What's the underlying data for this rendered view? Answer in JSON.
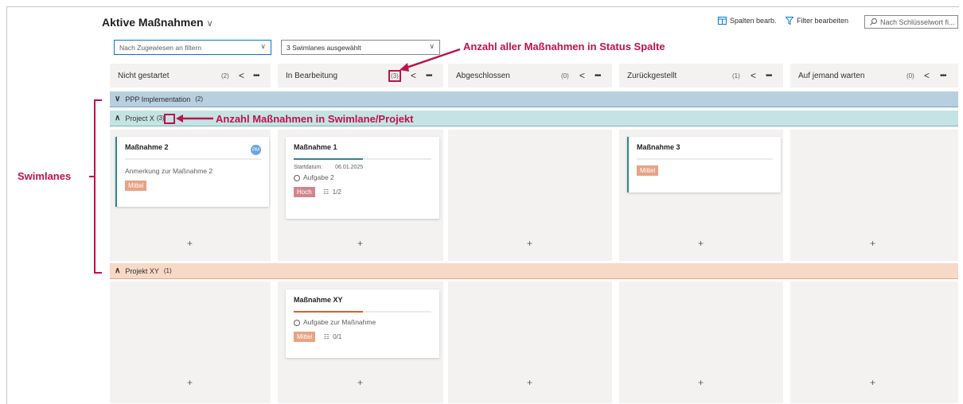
{
  "header": {
    "title": "Aktive Maßnahmen",
    "edit_columns_label": "Spalten bearb.",
    "edit_filter_label": "Filter bearbeiten",
    "search_placeholder": "Nach Schlüsselwort fi..."
  },
  "filters": {
    "assignee_placeholder": "Nach Zugewiesen an filtern",
    "swimlanes_selected": "3 Swimlanes ausgewählt"
  },
  "columns": [
    {
      "label": "Nicht gestartet",
      "count": "(2)"
    },
    {
      "label": "In Bearbeitung",
      "count": "(3)"
    },
    {
      "label": "Abgeschlossen",
      "count": "(0)"
    },
    {
      "label": "Zurückgestellt",
      "count": "(1)"
    },
    {
      "label": "Auf jemand warten",
      "count": "(0)"
    }
  ],
  "lanes": [
    {
      "label": "PPP Implementation",
      "count": "(2)"
    },
    {
      "label": "Project X",
      "count": "(3)"
    },
    {
      "label": "Projekt XY",
      "count": "(1)"
    }
  ],
  "cards": {
    "m2": {
      "title": "Maßnahme 2",
      "note": "Anmerkung zur Maßnahme 2",
      "priority": "Mittel",
      "avatar": "PM"
    },
    "m1": {
      "title": "Maßnahme 1",
      "start_label": "Startdatum:",
      "start_date": "06.01.2025",
      "task": "Aufgabe 2",
      "priority": "Hoch",
      "checklist": "1/2"
    },
    "m3": {
      "title": "Maßnahme 3",
      "priority": "Mittel"
    },
    "mxy": {
      "title": "Maßnahme XY",
      "task": "Aufgabe zur Maßnahme",
      "priority": "Mittel",
      "checklist": "0/1"
    }
  },
  "add_symbol": "+",
  "annotations": {
    "status_count": "Anzahl aller Maßnahmen in Status Spalte",
    "lane_count": "Anzahl Maßnahmen in Swimlane/Projekt",
    "swimlanes": "Swimlanes"
  },
  "colors": {
    "accent_red": "#c0114b",
    "lane_ppp": "#b8cfe0",
    "lane_projectx": "#c5e3e4",
    "lane_xy": "#f6d9c6",
    "progress_teal": "#2b8a8a",
    "progress_orange": "#d9622b"
  },
  "icons": [
    "chevron-down-icon",
    "columns-icon",
    "filter-icon",
    "search-icon",
    "chevron-left-icon",
    "more-icon",
    "chevron-up-icon",
    "avatar-icon",
    "checklist-icon",
    "circle-icon",
    "plus-icon"
  ]
}
